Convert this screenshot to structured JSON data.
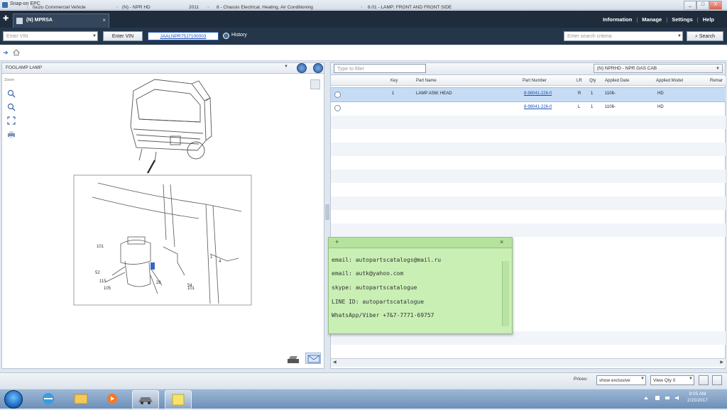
{
  "window": {
    "title": "Snap-on EPC",
    "buttons": [
      "_",
      "□",
      "X"
    ]
  },
  "app_header": {
    "active_tab": "(N) MPRSA",
    "menu": [
      "Information",
      "Manage",
      "Settings",
      "Help"
    ]
  },
  "toolbar": {
    "vin_placeholder": "Enter VIN",
    "vin_button": "Enter VIN",
    "vin_link": "JAALNPR75J7100003",
    "history_label": "History",
    "search_placeholder": "Enter search criteria",
    "search_button": "Search"
  },
  "breadcrumb": {
    "items": [
      "Isuzu Commercial Vehicle",
      "(N) - NPR HD",
      "2011",
      "8 - Chassis Electrical, Heating, Air Conditioning",
      "8.01 - LAMP; FRONT AND FRONT SIDE"
    ]
  },
  "left_panel": {
    "title": "FOGLAMP LAMP",
    "zoom_label": "Zoom",
    "callouts": [
      "101",
      "52",
      "115",
      "105",
      "28",
      "54",
      "101",
      "1 ",
      "4"
    ]
  },
  "right_panel": {
    "filter_placeholder": "Type to filter",
    "model_select": "(N) NPRHD - NPR GAS CAB",
    "columns": [
      "Key",
      "Part Name",
      "Part Number",
      "LR",
      "Qty",
      "Applied Date",
      "Applied Model",
      "Remar"
    ],
    "rows": [
      {
        "key": "1",
        "name": "LAMP ASM; HEAD",
        "number": "8-98041-226-0",
        "lr": "R",
        "qty": "1",
        "date": "1106-",
        "model": "HD"
      },
      {
        "key": "",
        "name": "",
        "number": "8-98041-226-0",
        "lr": "L",
        "qty": "1",
        "date": "1106-",
        "model": "HD"
      }
    ]
  },
  "note": {
    "plus": "+",
    "close": "×",
    "lines": [
      "email: autopartscatalogs@mail.ru",
      "email: autk@yahoo.com",
      "skype: autopartscatalogue",
      "LINE ID: autopartscatalogue",
      "WhatsApp/Viber +7&7-7771-69757"
    ]
  },
  "status_bar": {
    "prices_label": "Prices:",
    "price_select": "show exclusive",
    "view_select": "View Qty 0"
  },
  "taskbar": {
    "time": "9:05 AM",
    "date": "2/15/2017"
  }
}
